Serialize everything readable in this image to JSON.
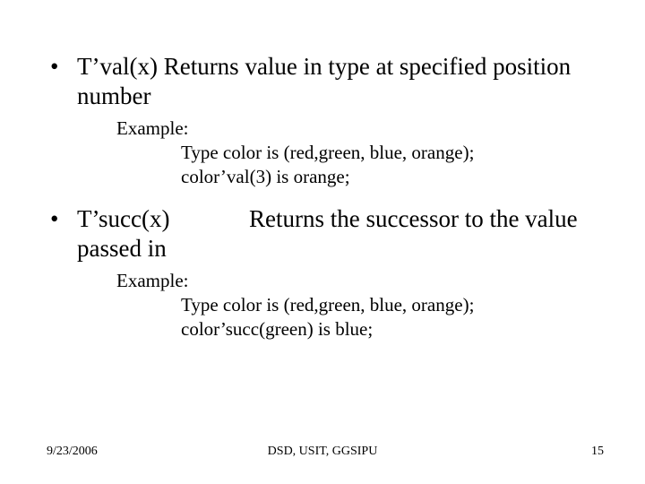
{
  "bullets": [
    {
      "text": "T’val(x) Returns value in type at specified position number",
      "example_label": "Example:",
      "example_lines": [
        "Type color is (red,green, blue, orange);",
        "color’val(3) is orange;"
      ]
    },
    {
      "name": "T’succ(x)",
      "desc": "Returns the successor to the value passed in",
      "example_label": "Example:",
      "example_lines": [
        "Type color is (red,green, blue, orange);",
        "color’succ(green) is blue;"
      ]
    }
  ],
  "footer": {
    "date": "9/23/2006",
    "center": "DSD, USIT, GGSIPU",
    "page": "15"
  }
}
